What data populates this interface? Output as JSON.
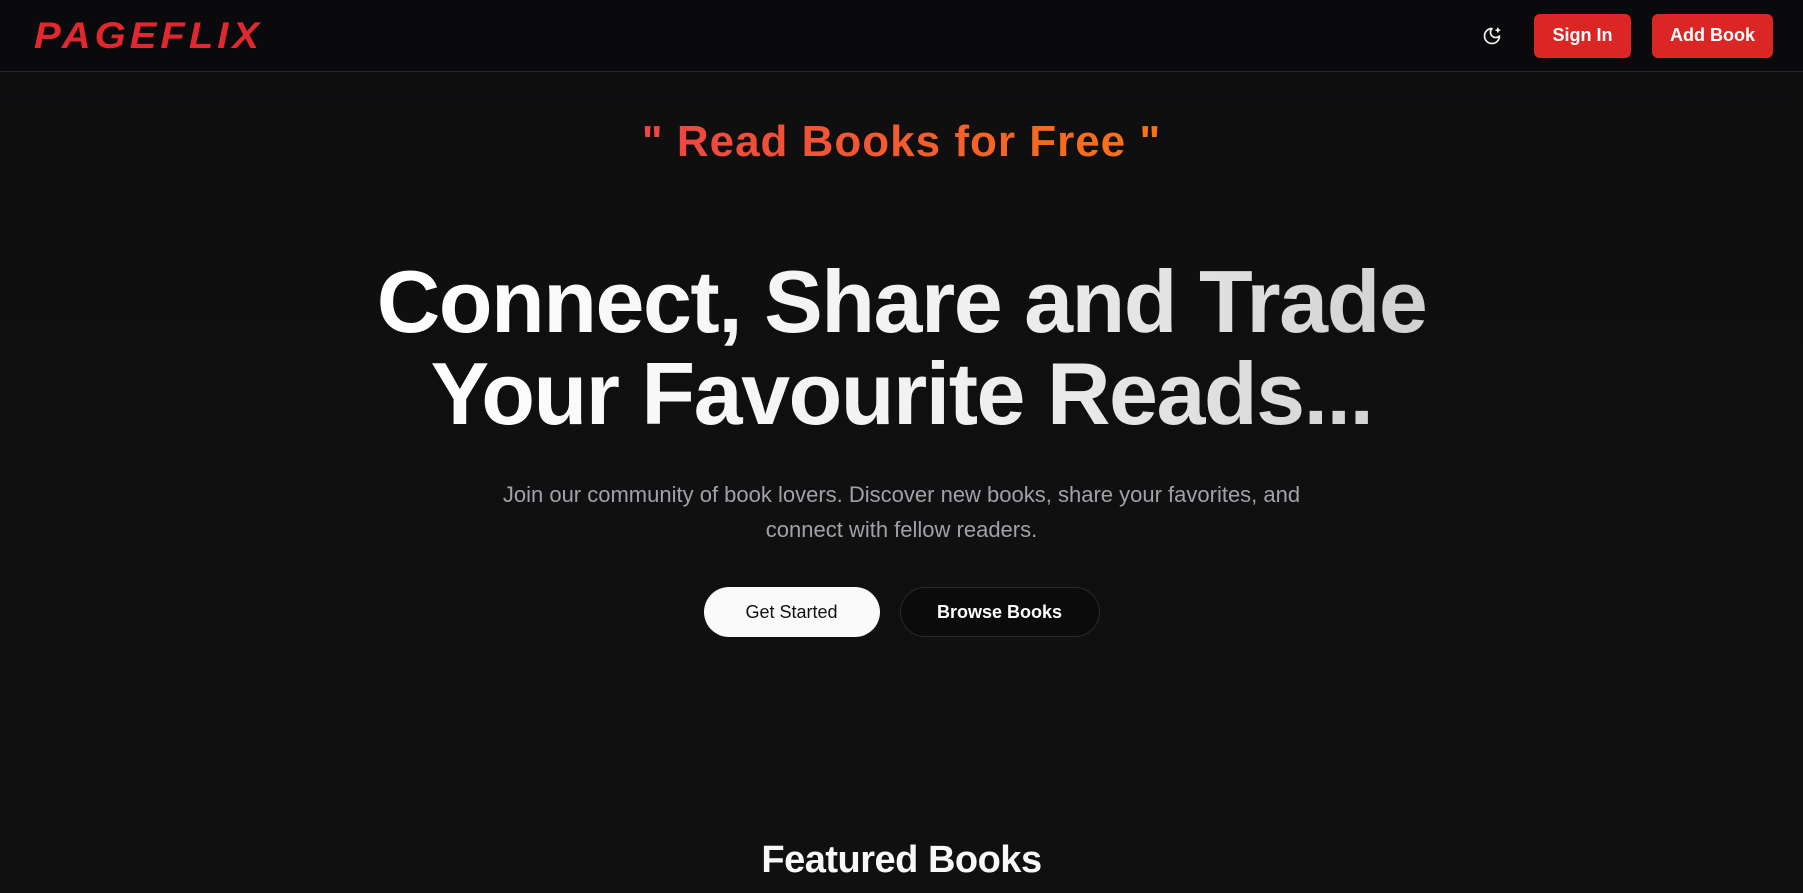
{
  "header": {
    "logo": "PAGEFLIX",
    "theme_toggle_icon": "moon-icon",
    "sign_in_label": "Sign In",
    "add_book_label": "Add Book"
  },
  "hero": {
    "tagline": "\" Read Books for Free \"",
    "headline_line1": "Connect, Share and Trade",
    "headline_line2": "Your Favourite Reads...",
    "subtitle": "Join our community of book lovers. Discover new books, share your favorites, and connect with fellow readers.",
    "primary_cta": "Get Started",
    "secondary_cta": "Browse Books"
  },
  "featured": {
    "title": "Featured Books"
  },
  "colors": {
    "brand_red": "#dc2626",
    "tagline_gradient_start": "#ef4444",
    "tagline_gradient_end": "#f97316",
    "background": "#0e0e0f"
  }
}
